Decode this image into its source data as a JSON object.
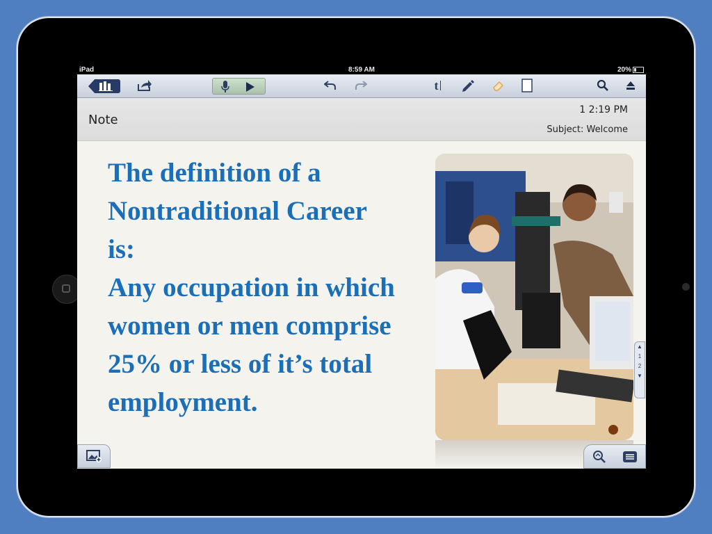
{
  "status_bar": {
    "device": "iPad",
    "time": "8:59 AM",
    "battery": "20%"
  },
  "toolbar": {
    "library_icon": "library-icon",
    "share_icon": "share-icon",
    "mic_icon": "microphone-icon",
    "play_icon": "play-icon",
    "undo_icon": "undo-icon",
    "redo_icon": "redo-icon",
    "text_tool_label": "t",
    "pen_icon": "pen-icon",
    "eraser_icon": "eraser-icon",
    "page_icon": "page-icon",
    "search_icon": "search-icon",
    "eject_icon": "eject-icon"
  },
  "note": {
    "title": "Note",
    "time": "1 2:19 PM",
    "subject": "Subject: Welcome"
  },
  "content": {
    "main_text": "The definition of a Nontraditional Career is:\nAny occupation in which women or men comprise  25% or less of it’s total employment."
  },
  "pager": {
    "page_1": "1",
    "page_2": "2"
  },
  "bottom_bar": {
    "add_image_icon": "add-image-icon",
    "zoom_icon": "zoom-icon",
    "menu_icon": "menu-icon"
  },
  "colors": {
    "text_blue": "#1a6fb8",
    "toolbar_navy": "#283b66",
    "background_blue": "#4f7fc0"
  }
}
